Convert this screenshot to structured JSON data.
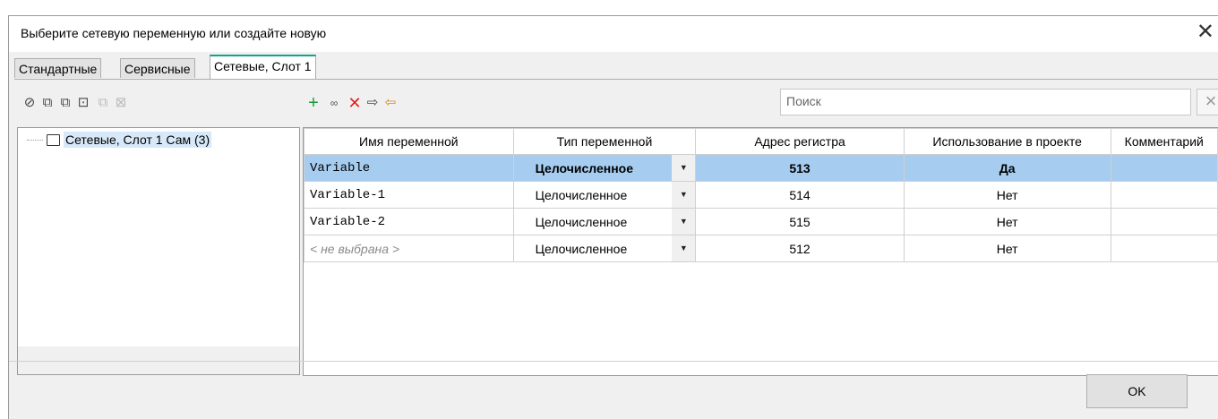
{
  "window": {
    "title": "Выберите сетевую переменную или создайте новую"
  },
  "tabs": [
    "Стандартные",
    "Сервисные",
    "Сетевые, Слот 1"
  ],
  "left_toolbar": [
    "view-icon",
    "expand-icon",
    "collapse-icon",
    "add-folder-icon",
    "copy-icon",
    "delete-folder-icon"
  ],
  "right_toolbar": [
    "add-icon",
    "link-variable-icon",
    "delete-icon",
    "export-icon",
    "import-icon"
  ],
  "search": {
    "placeholder": "Поиск"
  },
  "tree": {
    "root": "Сетевые, Слот 1 Сам (3)"
  },
  "table": {
    "columns": [
      "Имя переменной",
      "Тип переменной",
      "Адрес регистра",
      "Использование в проекте",
      "Комментарий"
    ],
    "rows": [
      {
        "name": "Variable",
        "type": "Целочисленное",
        "address": "513",
        "usage": "Да",
        "comment": ""
      },
      {
        "name": "Variable-1",
        "type": "Целочисленное",
        "address": "514",
        "usage": "Нет",
        "comment": ""
      },
      {
        "name": "Variable-2",
        "type": "Целочисленное",
        "address": "515",
        "usage": "Нет",
        "comment": ""
      },
      {
        "name": "< не выбрана >",
        "type": "Целочисленное",
        "address": "512",
        "usage": "Нет",
        "comment": ""
      }
    ]
  },
  "buttons": {
    "ok": "OK"
  },
  "colors": {
    "tab_accent": "#0aa68e",
    "selection": "#a6cdf0",
    "add_icon": "#1a9a3a",
    "delete_icon": "#e02020"
  }
}
